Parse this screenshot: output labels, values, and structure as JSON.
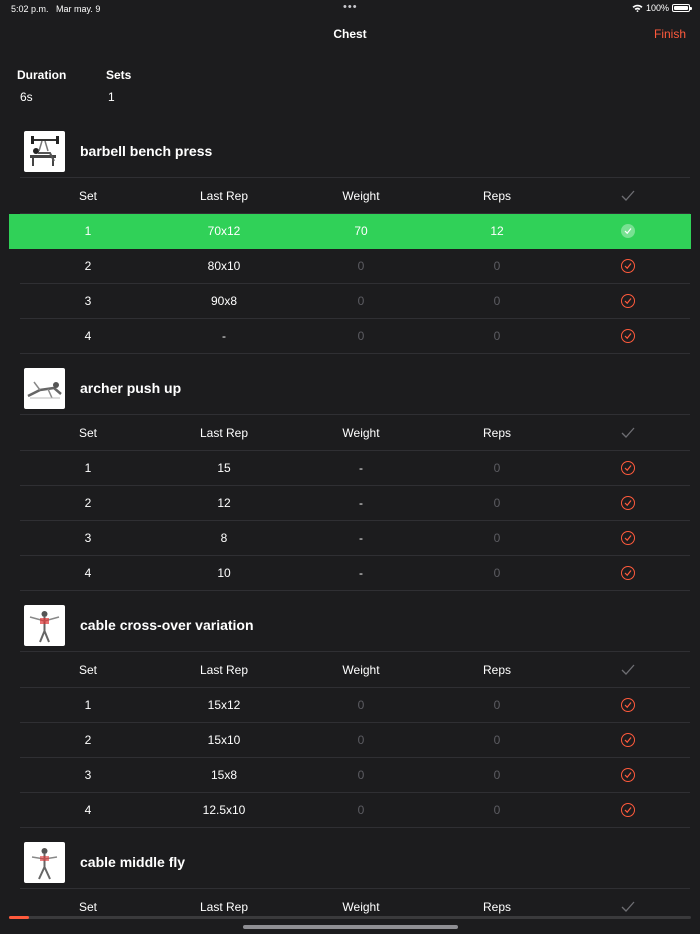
{
  "status": {
    "time": "5:02 p.m.",
    "date": "Mar may. 9",
    "battery": "100%",
    "battery_level": 1.0
  },
  "nav": {
    "title": "Chest",
    "finish": "Finish"
  },
  "summary": {
    "duration_label": "Duration",
    "duration_value": "6s",
    "sets_label": "Sets",
    "sets_value": "1"
  },
  "headers": {
    "set": "Set",
    "last_rep": "Last Rep",
    "weight": "Weight",
    "reps": "Reps"
  },
  "exercises": [
    {
      "name": "barbell bench press",
      "sets": [
        {
          "set": "1",
          "last": "70x12",
          "weight": "70",
          "reps": "12",
          "done": true
        },
        {
          "set": "2",
          "last": "80x10",
          "weight": "0",
          "reps": "0",
          "done": false
        },
        {
          "set": "3",
          "last": "90x8",
          "weight": "0",
          "reps": "0",
          "done": false
        },
        {
          "set": "4",
          "last": "-",
          "weight": "0",
          "reps": "0",
          "done": false
        }
      ]
    },
    {
      "name": "archer push up",
      "sets": [
        {
          "set": "1",
          "last": "15",
          "weight": "-",
          "reps": "0",
          "done": false
        },
        {
          "set": "2",
          "last": "12",
          "weight": "-",
          "reps": "0",
          "done": false
        },
        {
          "set": "3",
          "last": "8",
          "weight": "-",
          "reps": "0",
          "done": false
        },
        {
          "set": "4",
          "last": "10",
          "weight": "-",
          "reps": "0",
          "done": false
        }
      ]
    },
    {
      "name": "cable cross-over variation",
      "sets": [
        {
          "set": "1",
          "last": "15x12",
          "weight": "0",
          "reps": "0",
          "done": false
        },
        {
          "set": "2",
          "last": "15x10",
          "weight": "0",
          "reps": "0",
          "done": false
        },
        {
          "set": "3",
          "last": "15x8",
          "weight": "0",
          "reps": "0",
          "done": false
        },
        {
          "set": "4",
          "last": "12.5x10",
          "weight": "0",
          "reps": "0",
          "done": false
        }
      ]
    },
    {
      "name": "cable middle fly",
      "sets": []
    }
  ],
  "progress": 0.03,
  "colors": {
    "background": "#1c1c1e",
    "accent": "#ff5a3c",
    "active_row": "#30d158"
  }
}
